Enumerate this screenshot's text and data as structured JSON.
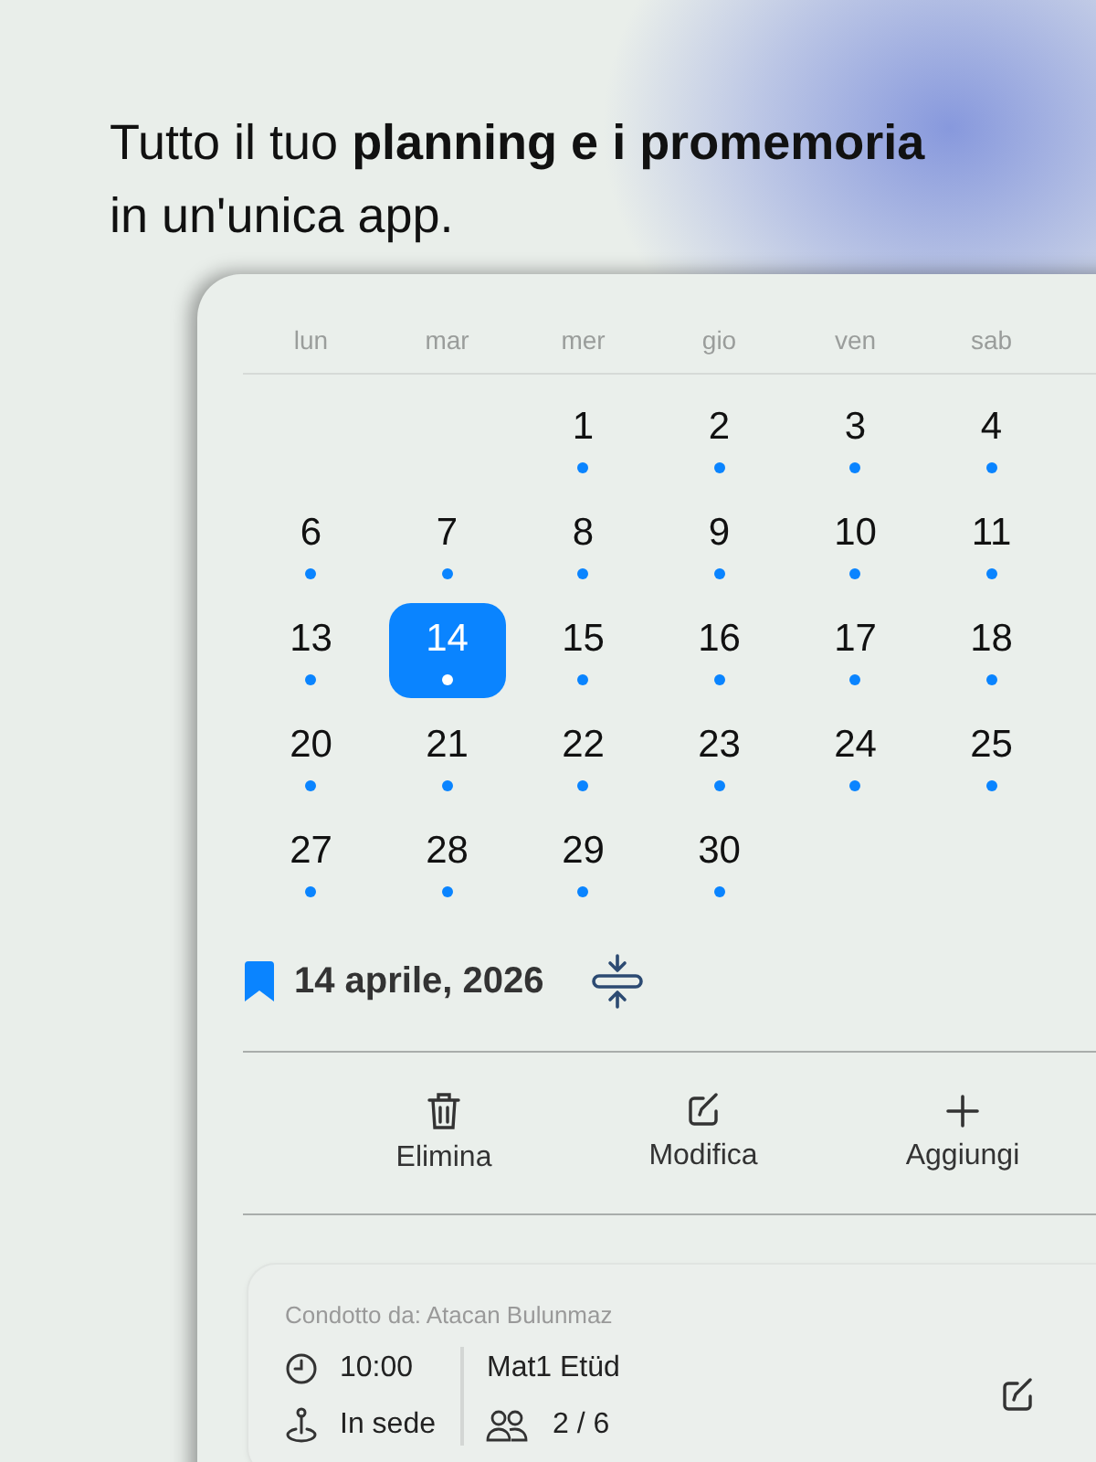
{
  "headline": "Tutto il tuo **planning e i promemoria**\nin un'unica app.",
  "calendar": {
    "weekdays": [
      "lun",
      "mar",
      "mer",
      "gio",
      "ven",
      "sab"
    ],
    "weeks": [
      [
        {
          "kind": "empty"
        },
        {
          "kind": "empty"
        },
        {
          "kind": "day",
          "day": "1",
          "has_event": true,
          "selected": false
        },
        {
          "kind": "day",
          "day": "2",
          "has_event": true,
          "selected": false
        },
        {
          "kind": "day",
          "day": "3",
          "has_event": true,
          "selected": false
        },
        {
          "kind": "day",
          "day": "4",
          "has_event": true,
          "selected": false
        }
      ],
      [
        {
          "kind": "day",
          "day": "6",
          "has_event": true,
          "selected": false
        },
        {
          "kind": "day",
          "day": "7",
          "has_event": true,
          "selected": false
        },
        {
          "kind": "day",
          "day": "8",
          "has_event": true,
          "selected": false
        },
        {
          "kind": "day",
          "day": "9",
          "has_event": true,
          "selected": false
        },
        {
          "kind": "day",
          "day": "10",
          "has_event": true,
          "selected": false
        },
        {
          "kind": "day",
          "day": "11",
          "has_event": true,
          "selected": false
        }
      ],
      [
        {
          "kind": "day",
          "day": "13",
          "has_event": true,
          "selected": false
        },
        {
          "kind": "day",
          "day": "14",
          "has_event": true,
          "selected": true
        },
        {
          "kind": "day",
          "day": "15",
          "has_event": true,
          "selected": false
        },
        {
          "kind": "day",
          "day": "16",
          "has_event": true,
          "selected": false
        },
        {
          "kind": "day",
          "day": "17",
          "has_event": true,
          "selected": false
        },
        {
          "kind": "day",
          "day": "18",
          "has_event": true,
          "selected": false
        }
      ],
      [
        {
          "kind": "day",
          "day": "20",
          "has_event": true,
          "selected": false
        },
        {
          "kind": "day",
          "day": "21",
          "has_event": true,
          "selected": false
        },
        {
          "kind": "day",
          "day": "22",
          "has_event": true,
          "selected": false
        },
        {
          "kind": "day",
          "day": "23",
          "has_event": true,
          "selected": false
        },
        {
          "kind": "day",
          "day": "24",
          "has_event": true,
          "selected": false
        },
        {
          "kind": "day",
          "day": "25",
          "has_event": true,
          "selected": false
        }
      ],
      [
        {
          "kind": "day",
          "day": "27",
          "has_event": true,
          "selected": false
        },
        {
          "kind": "day",
          "day": "28",
          "has_event": true,
          "selected": false
        },
        {
          "kind": "day",
          "day": "29",
          "has_event": true,
          "selected": false
        },
        {
          "kind": "day",
          "day": "30",
          "has_event": true,
          "selected": false
        }
      ]
    ]
  },
  "selected_date": "14 aprile, 2026",
  "actions": [
    {
      "kind": "delete",
      "label": "Elimina"
    },
    {
      "kind": "edit",
      "label": "Modifica"
    },
    {
      "kind": "add",
      "label": "Aggiungi"
    }
  ],
  "event": {
    "host": "Condotto da: Atacan Bulunmaz",
    "time": "10:00",
    "location": "In sede",
    "title": "Mat1 Etüd",
    "participants": "2 / 6"
  }
}
